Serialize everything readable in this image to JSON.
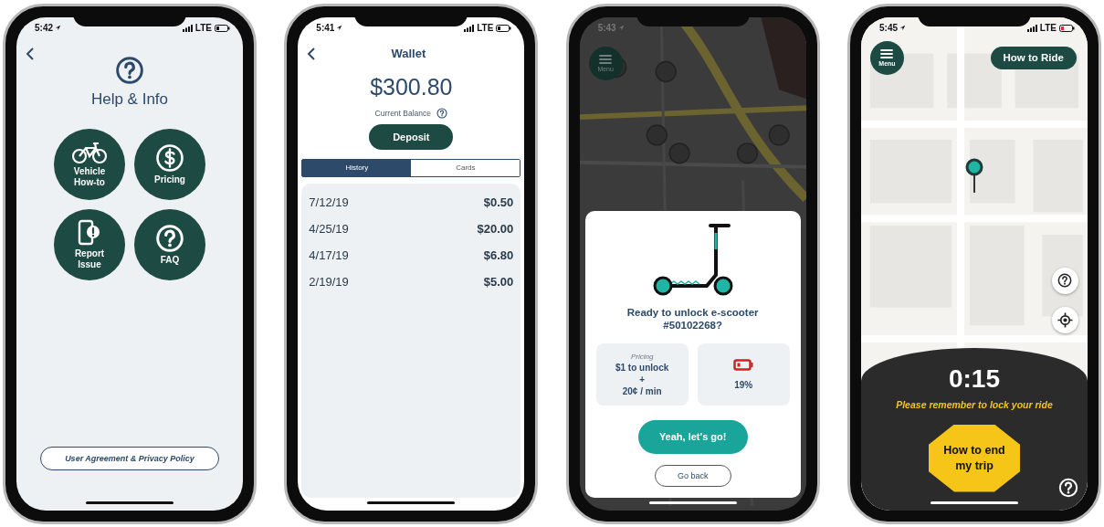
{
  "phones": [
    {
      "kind": "help",
      "time": "5:42",
      "carrier": "LTE",
      "title": "Help & Info",
      "tiles": [
        {
          "kind": "bicycle",
          "label": "Vehicle How-to"
        },
        {
          "kind": "dollar",
          "label": "Pricing"
        },
        {
          "kind": "phone-alert",
          "label": "Report Issue"
        },
        {
          "kind": "question",
          "label": "FAQ"
        }
      ],
      "footer_link": "User Agreement & Privacy Policy"
    },
    {
      "kind": "wallet",
      "time": "5:41",
      "carrier": "LTE",
      "title": "Wallet",
      "balance": "$300.80",
      "balance_label": "Current Balance",
      "deposit": "Deposit",
      "tabs": [
        {
          "label": "History",
          "selected": true
        },
        {
          "label": "Cards",
          "selected": false
        }
      ],
      "transactions": [
        {
          "date": "7/12/19",
          "amount": "$0.50"
        },
        {
          "date": "4/25/19",
          "amount": "$20.00"
        },
        {
          "date": "4/17/19",
          "amount": "$6.80"
        },
        {
          "date": "2/19/19",
          "amount": "$5.00"
        }
      ]
    },
    {
      "kind": "unlock",
      "time": "5:43",
      "menu": "Menu",
      "prompt": "Ready to unlock e-scooter #50102268?",
      "pricing_title": "Pricing",
      "pricing_lines": [
        "$1 to unlock",
        "+",
        "20¢ / min"
      ],
      "battery": "19%",
      "confirm": "Yeah, let's go!",
      "back": "Go back"
    },
    {
      "kind": "ride",
      "time": "5:45",
      "carrier": "LTE",
      "menu": "Menu",
      "how_to_ride": "How to Ride",
      "timer": "0:15",
      "reminder": "Please remember to lock your ride",
      "end_trip": "How to end my trip"
    }
  ]
}
